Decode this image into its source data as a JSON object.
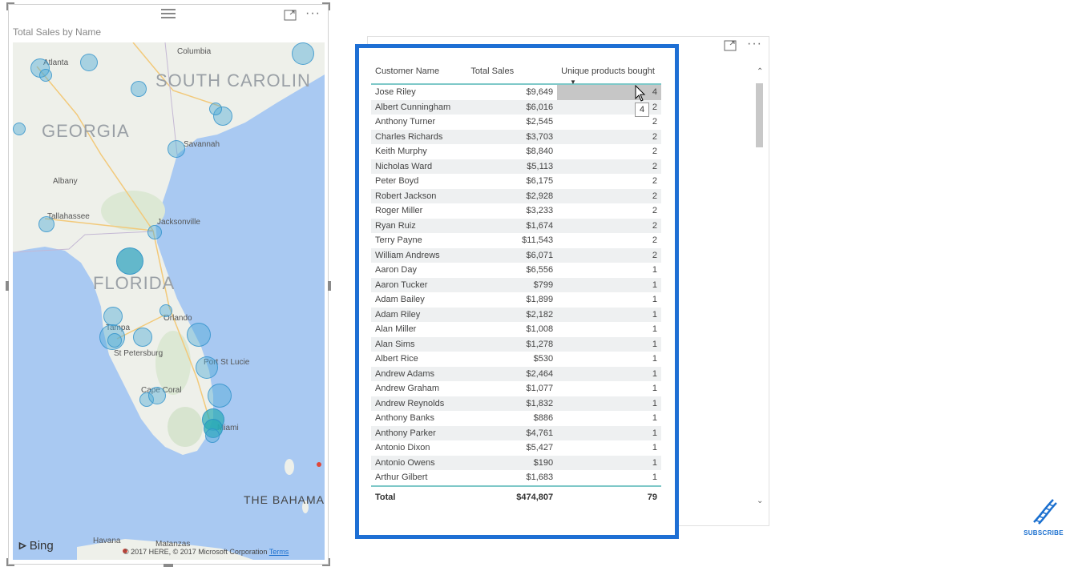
{
  "map": {
    "title": "Total Sales by Name",
    "state_labels": [
      "SOUTH CAROLIN",
      "GEORGIA",
      "FLORIDA",
      "THE BAHAMA"
    ],
    "cities": [
      "Atlanta",
      "Columbia",
      "Savannah",
      "Albany",
      "Tallahassee",
      "Jacksonville",
      "Orlando",
      "Tampa",
      "St Petersburg",
      "Port St Lucie",
      "Cape Coral",
      "Miami",
      "Havana",
      "Matanzas"
    ],
    "bing_label": "Bing",
    "copyright": "© 2017 HERE, © 2017 Microsoft Corporation",
    "terms": "Terms"
  },
  "table": {
    "headers": [
      "Customer Name",
      "Total Sales",
      "Unique products bought"
    ],
    "rows": [
      [
        "Jose Riley",
        "$9,649",
        "4"
      ],
      [
        "Albert Cunningham",
        "$6,016",
        "2"
      ],
      [
        "Anthony Turner",
        "$2,545",
        "2"
      ],
      [
        "Charles Richards",
        "$3,703",
        "2"
      ],
      [
        "Keith Murphy",
        "$8,840",
        "2"
      ],
      [
        "Nicholas Ward",
        "$5,113",
        "2"
      ],
      [
        "Peter Boyd",
        "$6,175",
        "2"
      ],
      [
        "Robert Jackson",
        "$2,928",
        "2"
      ],
      [
        "Roger Miller",
        "$3,233",
        "2"
      ],
      [
        "Ryan Ruiz",
        "$1,674",
        "2"
      ],
      [
        "Terry Payne",
        "$11,543",
        "2"
      ],
      [
        "William Andrews",
        "$6,071",
        "2"
      ],
      [
        "Aaron Day",
        "$6,556",
        "1"
      ],
      [
        "Aaron Tucker",
        "$799",
        "1"
      ],
      [
        "Adam Bailey",
        "$1,899",
        "1"
      ],
      [
        "Adam Riley",
        "$2,182",
        "1"
      ],
      [
        "Alan Miller",
        "$1,008",
        "1"
      ],
      [
        "Alan Sims",
        "$1,278",
        "1"
      ],
      [
        "Albert Rice",
        "$530",
        "1"
      ],
      [
        "Andrew Adams",
        "$2,464",
        "1"
      ],
      [
        "Andrew Graham",
        "$1,077",
        "1"
      ],
      [
        "Andrew Reynolds",
        "$1,832",
        "1"
      ],
      [
        "Anthony Banks",
        "$886",
        "1"
      ],
      [
        "Anthony Parker",
        "$4,761",
        "1"
      ],
      [
        "Antonio Dixon",
        "$5,427",
        "1"
      ],
      [
        "Antonio Owens",
        "$190",
        "1"
      ],
      [
        "Arthur Gilbert",
        "$1,683",
        "1"
      ]
    ],
    "total": {
      "label": "Total",
      "sales": "$474,807",
      "products": "79"
    },
    "tooltip_value": "4"
  },
  "subscribe_label": "SUBSCRIBE",
  "colors": {
    "frame": "#1e6fd4",
    "water": "#a9c9f2",
    "land": "#eef0ea",
    "bubble": "#50aad7"
  }
}
